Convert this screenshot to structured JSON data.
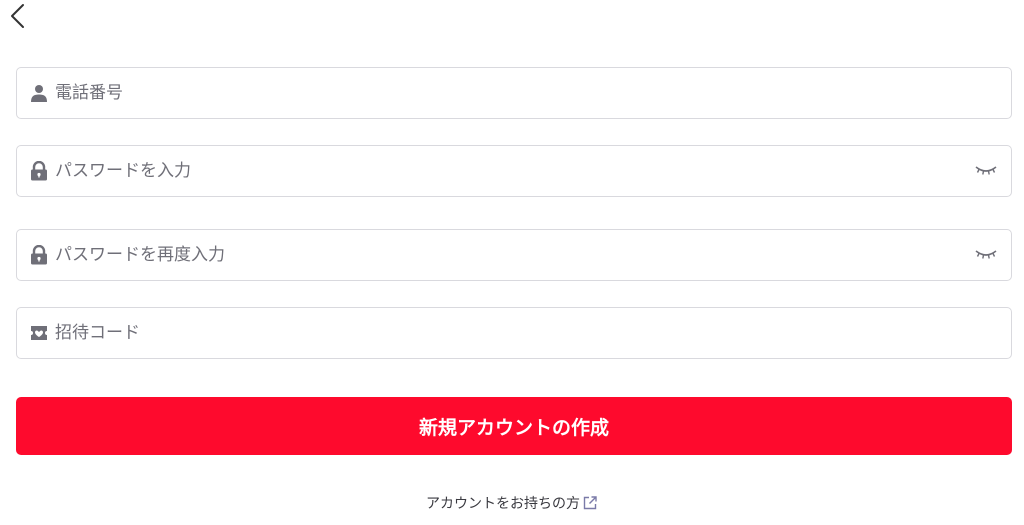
{
  "form": {
    "phone": {
      "placeholder": "電話番号",
      "icon": "person-icon"
    },
    "password": {
      "placeholder": "パスワードを入力",
      "icon": "lock-icon"
    },
    "password_confirm": {
      "placeholder": "パスワードを再度入力",
      "icon": "lock-icon"
    },
    "invite_code": {
      "placeholder": "招待コード",
      "icon": "ticket-icon"
    },
    "submit_label": "新規アカウントの作成",
    "login_link_label": "アカウントをお持ちの方"
  },
  "colors": {
    "accent": "#fe0a2d",
    "icon": "#6f6f78",
    "border": "#d9d9de"
  }
}
